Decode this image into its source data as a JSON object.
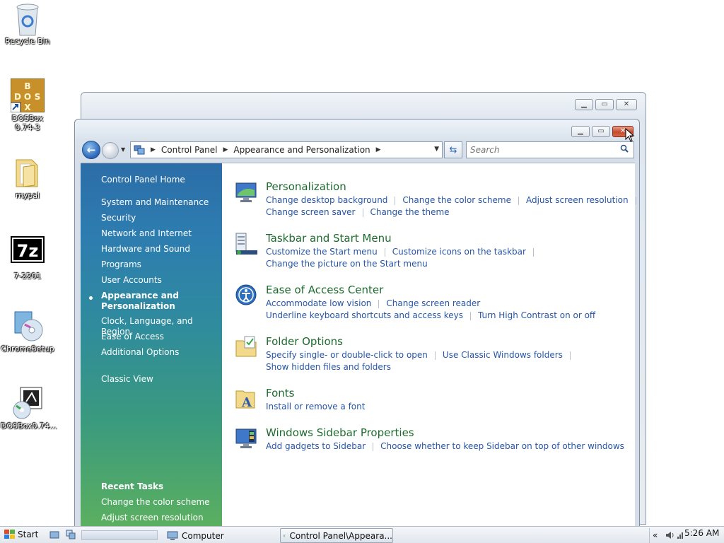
{
  "desktop": {
    "icons": [
      {
        "name": "recycle-bin",
        "label": "Recycle Bin"
      },
      {
        "name": "dosbox",
        "label": "DOSBox 0.74-3",
        "line1": "DOSBox",
        "line2": "0.74-3"
      },
      {
        "name": "mypal",
        "label": "mypal"
      },
      {
        "name": "7zip",
        "label": "7-2201"
      },
      {
        "name": "chromesetup",
        "label": "ChromeSetup"
      },
      {
        "name": "dosbox-installer",
        "label": "DOSBox0.74..."
      }
    ]
  },
  "window": {
    "address": {
      "crumbs": [
        "Control Panel",
        "Appearance and Personalization"
      ]
    },
    "search_placeholder": "Search",
    "sidebar": {
      "items": [
        "Control Panel Home",
        "System and Maintenance",
        "Security",
        "Network and Internet",
        "Hardware and Sound",
        "Programs",
        "User Accounts",
        "Appearance and Personalization",
        "Clock, Language, and Region",
        "Ease of Access",
        "Additional Options",
        "Classic View"
      ],
      "active_line1": "Appearance and",
      "active_line2": "Personalization",
      "recent_title": "Recent Tasks",
      "recent": [
        "Change the color scheme",
        "Adjust screen resolution"
      ]
    },
    "categories": [
      {
        "title": "Personalization",
        "rows": [
          [
            "Change desktop background",
            "Change the color scheme",
            "Adjust screen resolution"
          ],
          [
            "Change screen saver",
            "Change the theme"
          ]
        ]
      },
      {
        "title": "Taskbar and Start Menu",
        "rows": [
          [
            "Customize the Start menu",
            "Customize icons on the taskbar"
          ],
          [
            "Change the picture on the Start menu"
          ]
        ]
      },
      {
        "title": "Ease of Access Center",
        "rows": [
          [
            "Accommodate low vision",
            "Change screen reader"
          ],
          [
            "Underline keyboard shortcuts and access keys",
            "Turn High Contrast on or off"
          ]
        ]
      },
      {
        "title": "Folder Options",
        "rows": [
          [
            "Specify single- or double-click to open",
            "Use Classic Windows folders"
          ],
          [
            "Show hidden files and folders"
          ]
        ]
      },
      {
        "title": "Fonts",
        "rows": [
          [
            "Install or remove a font"
          ]
        ]
      },
      {
        "title": "Windows Sidebar Properties",
        "rows": [
          [
            "Add gadgets to Sidebar",
            "Choose whether to keep Sidebar on top of other windows"
          ]
        ]
      }
    ]
  },
  "taskbar": {
    "start_label": "Start",
    "tasks": [
      "Computer",
      "Control Panel\\Appeara..."
    ],
    "clock": "5:26 AM",
    "tray_chevron": "«"
  },
  "colors": {
    "link": "#2755a7",
    "category_title": "#1e6b2e",
    "sidebar_top": "#2c6da8",
    "sidebar_bottom": "#5cb05e"
  }
}
